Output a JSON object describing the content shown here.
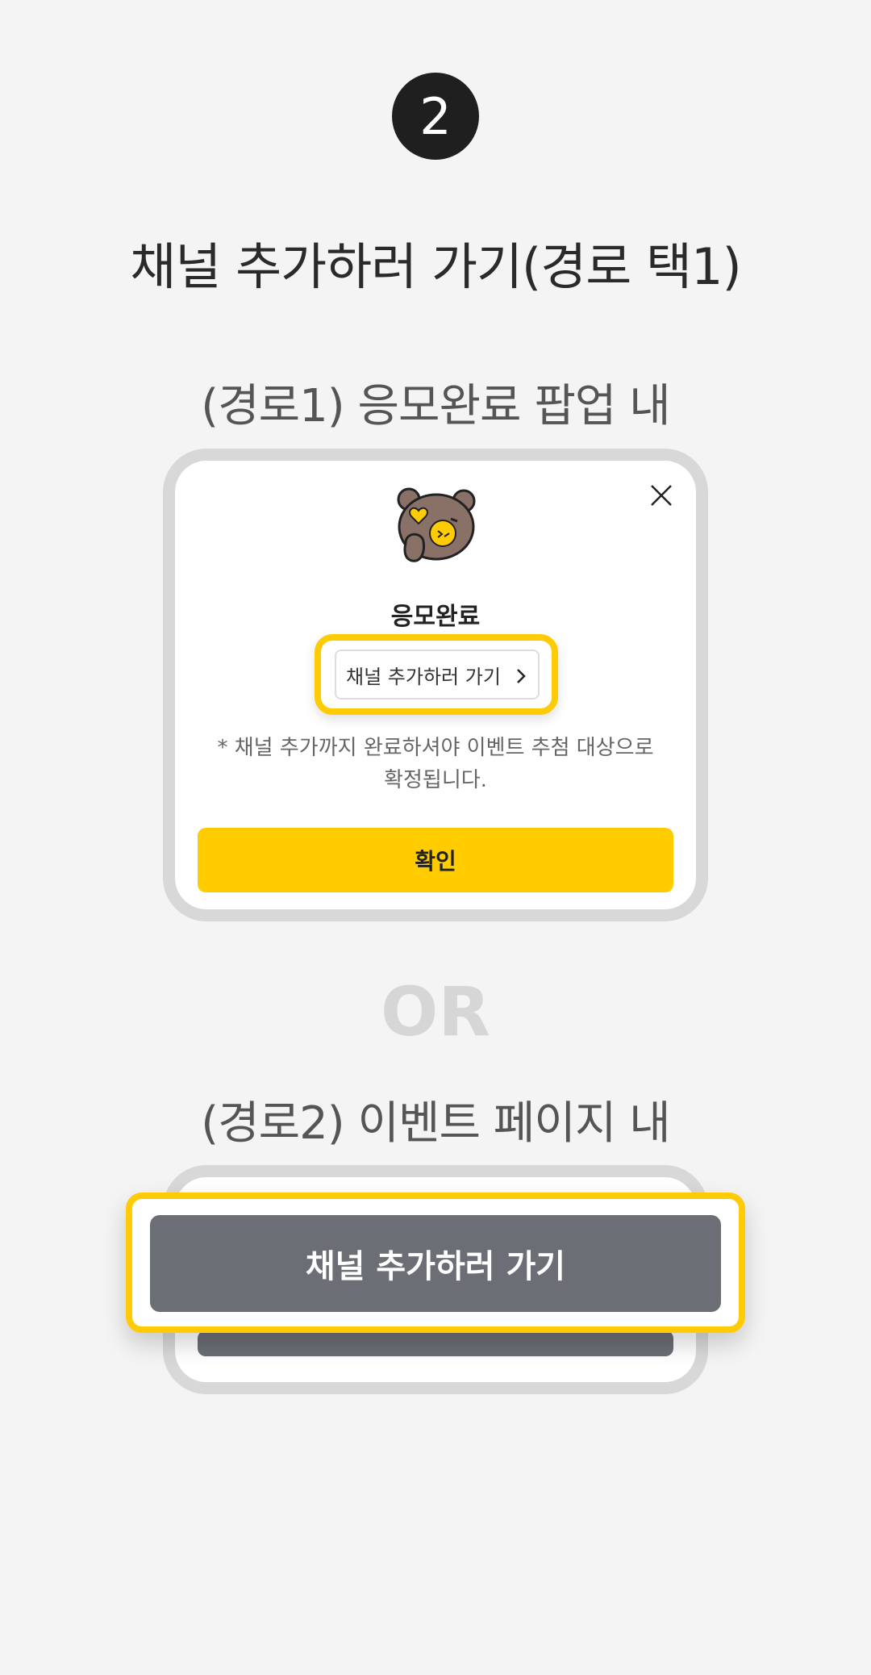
{
  "step_number": "2",
  "main_title": "채널 추가하러 가기(경로 택1)",
  "route1": {
    "title": "(경로1) 응모완료 팝업 내",
    "popup": {
      "heading": "응모완료",
      "channel_button_label": "채널 추가하러 가기",
      "notice_line1": "* 채널 추가까지 완료하셔야 이벤트 추첨 대상으로",
      "notice_line2": "확정됩니다.",
      "confirm_label": "확인"
    }
  },
  "or_label": "OR",
  "route2": {
    "title": "(경로2) 이벤트 페이지 내",
    "channel_button_label": "채널 추가하러 가기"
  },
  "colors": {
    "background": "#f4f4f4",
    "highlight": "#ffcb05",
    "confirm": "#ffcc00",
    "channel_button": "#6b6e75",
    "badge": "#1f1f1f"
  }
}
